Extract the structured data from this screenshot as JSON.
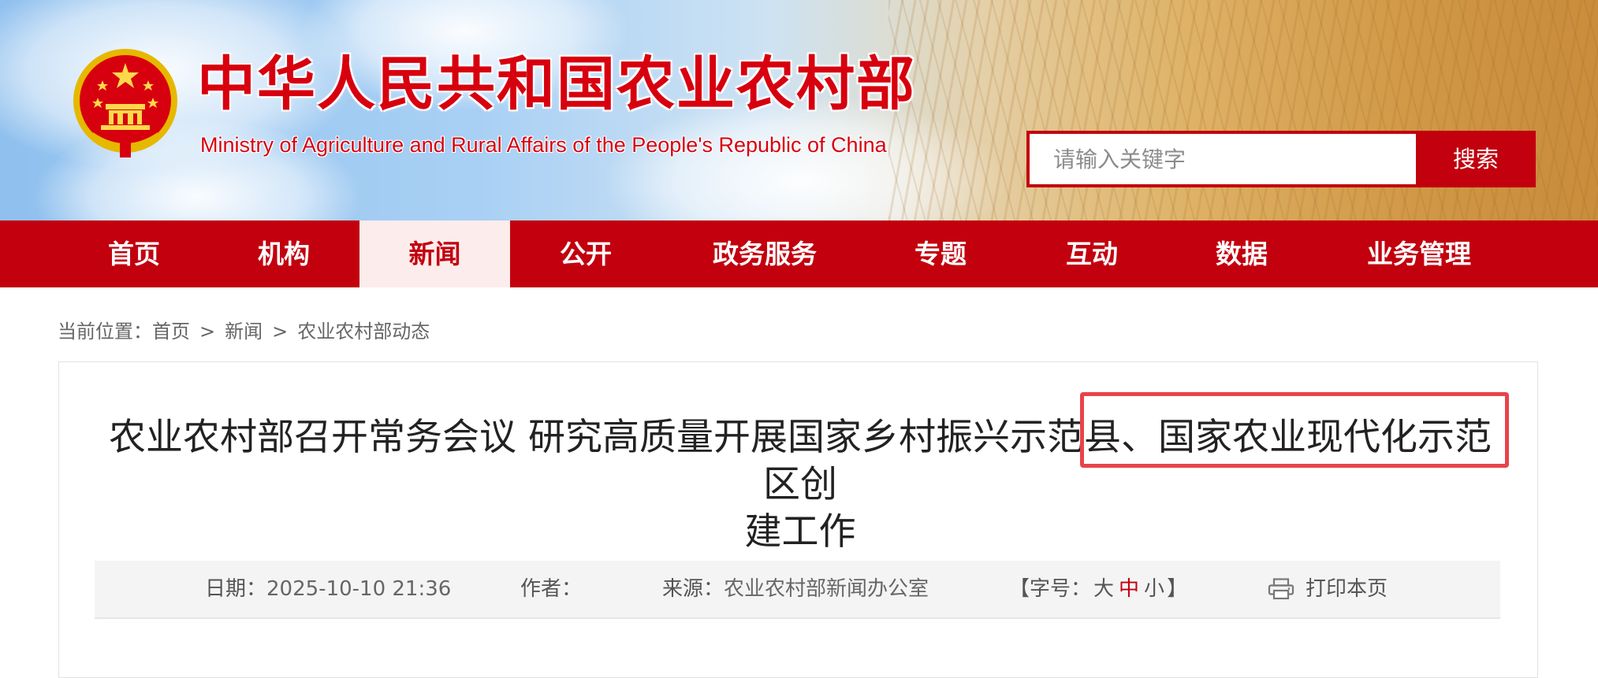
{
  "header": {
    "title": "中华人民共和国农业农村部",
    "subtitle": "Ministry of Agriculture and Rural Affairs of the People's Republic of China",
    "emblem_icon": "national-emblem-icon"
  },
  "search": {
    "placeholder": "请输入关键字",
    "button_label": "搜索"
  },
  "nav": {
    "items": [
      {
        "label": "首页"
      },
      {
        "label": "机构"
      },
      {
        "label": "新闻",
        "active": true
      },
      {
        "label": "公开"
      },
      {
        "label": "政务服务"
      },
      {
        "label": "专题"
      },
      {
        "label": "互动"
      },
      {
        "label": "数据"
      },
      {
        "label": "业务管理"
      }
    ]
  },
  "breadcrumb": {
    "prefix": "当前位置：",
    "items": [
      "首页",
      "新闻",
      "农业农村部动态"
    ],
    "separator": ">"
  },
  "article": {
    "title_line1": "农业农村部召开常务会议 研究高质量开展国家乡村振兴示范县、国家农业现代化示范区创",
    "title_line2": "建工作",
    "meta": {
      "date_label": "日期：",
      "date_value": "2025-10-10 21:36",
      "author_label": "作者：",
      "author_value": "",
      "source_label": "来源：",
      "source_value": "农业农村部新闻办公室",
      "font_open": "【字号：",
      "font_large": "大",
      "font_medium": "中",
      "font_small": "小",
      "font_close": "】",
      "print_label": "打印本页"
    }
  },
  "colors": {
    "brand_red": "#c2000e",
    "title_red": "#d7000f",
    "highlight_border": "#e9434a",
    "active_nav_bg": "#fcecec"
  }
}
